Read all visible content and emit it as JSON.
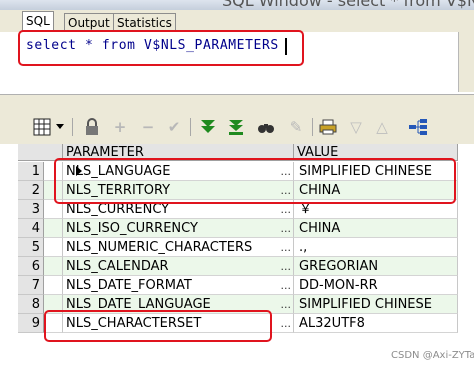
{
  "window": {
    "title": "SQL Window - select * from V$NLS_PARAMETERS"
  },
  "tabs": [
    {
      "label": "SQL",
      "active": true
    },
    {
      "label": "Output",
      "active": false
    },
    {
      "label": "Statistics",
      "active": false
    }
  ],
  "editor": {
    "sql": "select * from V$NLS_PARAMETERS"
  },
  "toolbar": {
    "icons": [
      "grid-icon",
      "dropdown-arrow-icon",
      "lock-icon",
      "add-icon",
      "remove-icon",
      "post-changes-icon",
      "fetch-next-icon",
      "fetch-all-icon",
      "find-icon",
      "clear-icon",
      "print-icon",
      "filter-icon",
      "filter-up-icon",
      "tree-icon"
    ]
  },
  "grid": {
    "columns": [
      "PARAMETER",
      "VALUE"
    ],
    "cell_button": "...",
    "rows": [
      {
        "num": "1",
        "parameter": "NLS_LANGUAGE",
        "value": "SIMPLIFIED CHINESE"
      },
      {
        "num": "2",
        "parameter": "NLS_TERRITORY",
        "value": "CHINA"
      },
      {
        "num": "3",
        "parameter": "NLS_CURRENCY",
        "value": "￥"
      },
      {
        "num": "4",
        "parameter": "NLS_ISO_CURRENCY",
        "value": "CHINA"
      },
      {
        "num": "5",
        "parameter": "NLS_NUMERIC_CHARACTERS",
        "value": ".,"
      },
      {
        "num": "6",
        "parameter": "NLS_CALENDAR",
        "value": "GREGORIAN"
      },
      {
        "num": "7",
        "parameter": "NLS_DATE_FORMAT",
        "value": "DD-MON-RR"
      },
      {
        "num": "8",
        "parameter": "NLS_DATE_LANGUAGE",
        "value": "SIMPLIFIED CHINESE"
      },
      {
        "num": "9",
        "parameter": "NLS_CHARACTERSET",
        "value": "AL32UTF8"
      }
    ]
  },
  "watermark": "CSDN @Axi-ZYTao",
  "colors": {
    "sql_keyword": "#00008b",
    "alt_row": "#ecf8ea",
    "annotation_red": "#e0141e"
  }
}
